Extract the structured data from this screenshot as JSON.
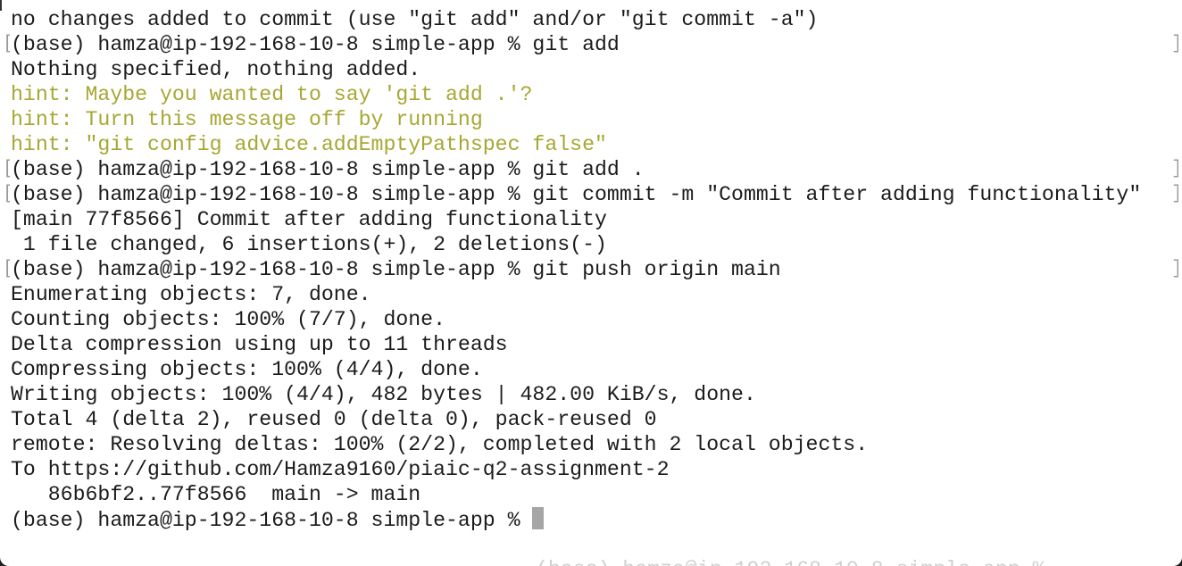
{
  "terminal": {
    "lines": [
      {
        "text": "no changes added to commit (use \"git add\" and/or \"git commit -a\")",
        "kind": "output",
        "bracket": false
      },
      {
        "text": "(base) hamza@ip-192-168-10-8 simple-app % git add",
        "kind": "prompt",
        "bracket": true
      },
      {
        "text": "Nothing specified, nothing added.",
        "kind": "output",
        "bracket": false
      },
      {
        "text": "hint: Maybe you wanted to say 'git add .'?",
        "kind": "hint",
        "bracket": false
      },
      {
        "text": "hint: Turn this message off by running",
        "kind": "hint",
        "bracket": false
      },
      {
        "text": "hint: \"git config advice.addEmptyPathspec false\"",
        "kind": "hint",
        "bracket": false
      },
      {
        "text": "(base) hamza@ip-192-168-10-8 simple-app % git add .",
        "kind": "prompt",
        "bracket": true
      },
      {
        "text": "(base) hamza@ip-192-168-10-8 simple-app % git commit -m \"Commit after adding functionality\"",
        "kind": "prompt",
        "bracket": true
      },
      {
        "text": "[main 77f8566] Commit after adding functionality",
        "kind": "output",
        "bracket": false
      },
      {
        "text": " 1 file changed, 6 insertions(+), 2 deletions(-)",
        "kind": "output",
        "bracket": false
      },
      {
        "text": "(base) hamza@ip-192-168-10-8 simple-app % git push origin main",
        "kind": "prompt",
        "bracket": true
      },
      {
        "text": "Enumerating objects: 7, done.",
        "kind": "output",
        "bracket": false
      },
      {
        "text": "Counting objects: 100% (7/7), done.",
        "kind": "output",
        "bracket": false
      },
      {
        "text": "Delta compression using up to 11 threads",
        "kind": "output",
        "bracket": false
      },
      {
        "text": "Compressing objects: 100% (4/4), done.",
        "kind": "output",
        "bracket": false
      },
      {
        "text": "Writing objects: 100% (4/4), 482 bytes | 482.00 KiB/s, done.",
        "kind": "output",
        "bracket": false
      },
      {
        "text": "Total 4 (delta 2), reused 0 (delta 0), pack-reused 0",
        "kind": "output",
        "bracket": false
      },
      {
        "text": "remote: Resolving deltas: 100% (2/2), completed with 2 local objects.",
        "kind": "output",
        "bracket": false
      },
      {
        "text": "To https://github.com/Hamza9160/piaic-q2-assignment-2",
        "kind": "output",
        "bracket": false
      },
      {
        "text": "   86b6bf2..77f8566  main -> main",
        "kind": "output",
        "bracket": false
      },
      {
        "text": "(base) hamza@ip-192-168-10-8 simple-app % ",
        "kind": "current-prompt",
        "bracket": false
      }
    ],
    "colors": {
      "background": "#ffffff",
      "text": "#1b1b1b",
      "hint": "#a7a734",
      "cursor": "#a5a5a5"
    }
  }
}
